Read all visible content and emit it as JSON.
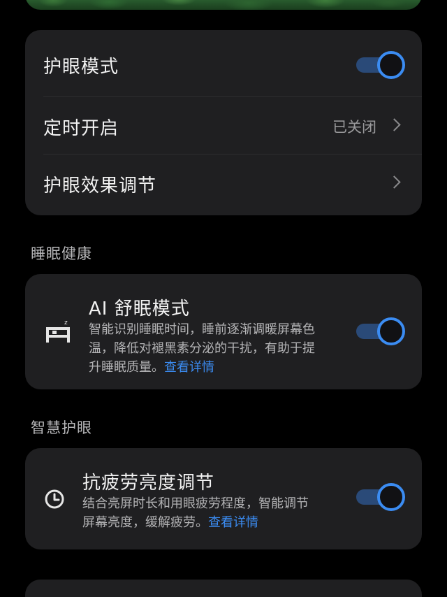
{
  "eye_care": {
    "mode_label": "护眼模式",
    "mode_enabled": true,
    "schedule_label": "定时开启",
    "schedule_value": "已关闭",
    "adjust_label": "护眼效果调节"
  },
  "sleep_section": {
    "header": "睡眠健康",
    "title": "AI 舒眠模式",
    "desc_line1": "智能识别睡眠时间，睡前逐渐调暖屏幕色",
    "desc_line2": "温，降低对褪黑素分泌的干扰，有助于提",
    "desc_line3": "升睡眠质量。",
    "link": "查看详情",
    "enabled": true,
    "icon": "bed-icon"
  },
  "smart_section": {
    "header": "智慧护眼",
    "title": "抗疲劳亮度调节",
    "desc_line1": "结合亮屏时长和用眼疲劳程度，智能调节",
    "desc_line2": "屏幕亮度，缓解疲劳。",
    "link": "查看详情",
    "enabled": true,
    "icon": "clock-icon"
  },
  "colors": {
    "background": "#000000",
    "card": "#1f1f21",
    "accent": "#3b8cf2",
    "toggle_track": "#2a4a78"
  }
}
